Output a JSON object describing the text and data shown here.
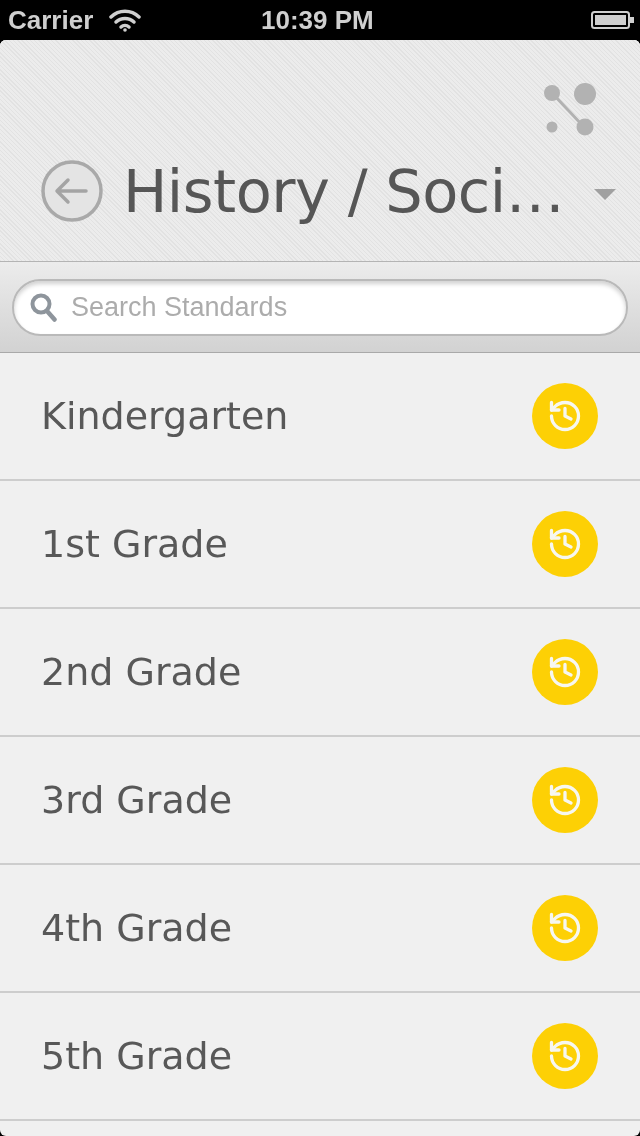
{
  "status_bar": {
    "carrier": "Carrier",
    "time": "10:39 PM"
  },
  "header": {
    "title": "History / Soci…"
  },
  "search": {
    "placeholder": "Search Standards"
  },
  "grades": [
    {
      "label": "Kindergarten"
    },
    {
      "label": "1st Grade"
    },
    {
      "label": "2nd Grade"
    },
    {
      "label": "3rd Grade"
    },
    {
      "label": "4th Grade"
    },
    {
      "label": "5th Grade"
    }
  ]
}
